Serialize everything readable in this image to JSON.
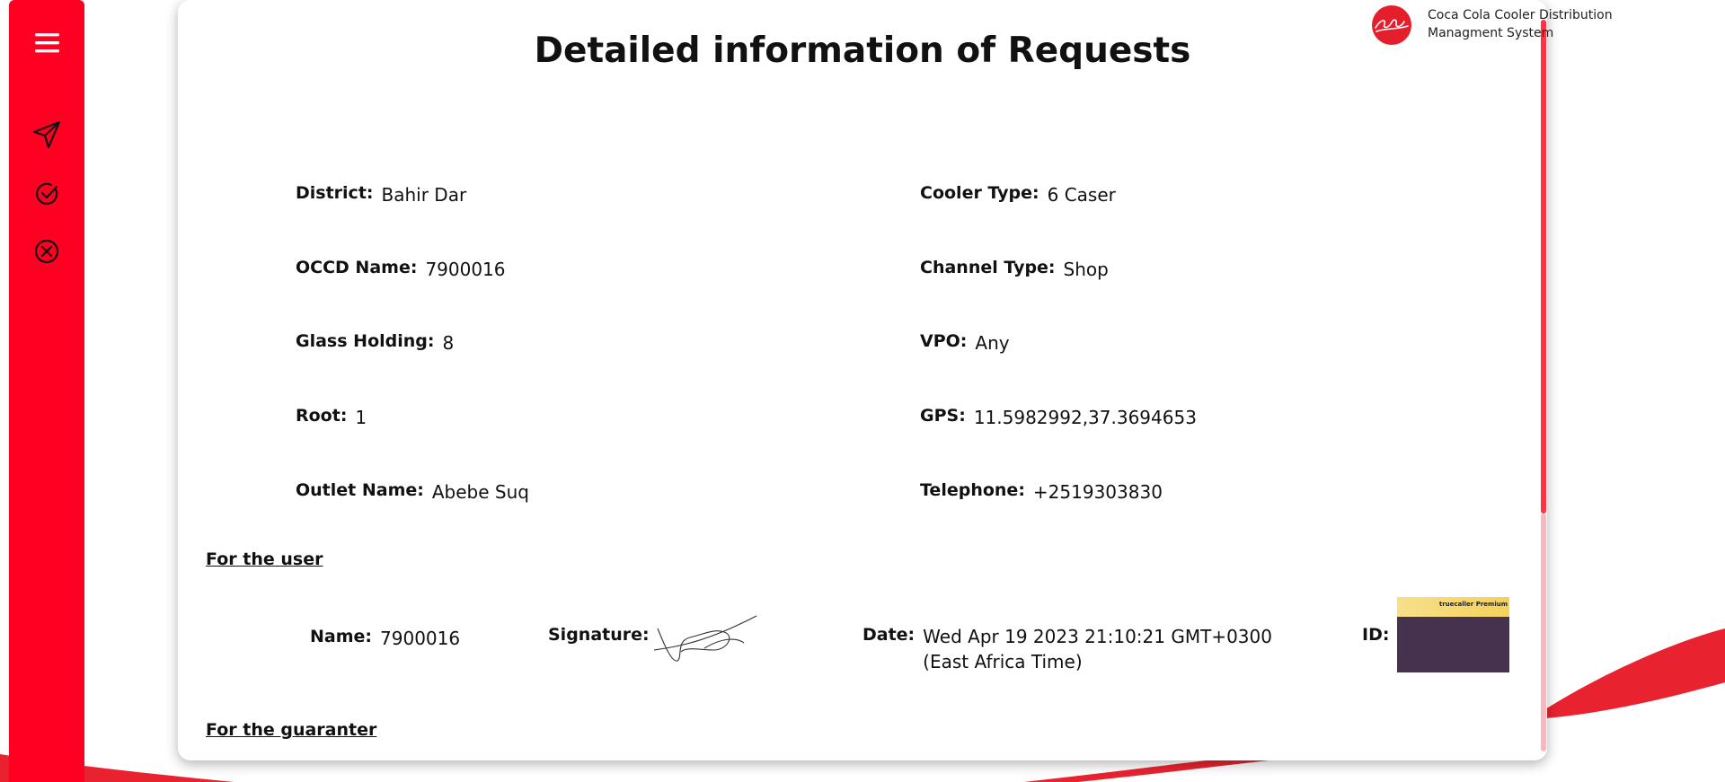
{
  "app": {
    "name_line1": "Coca Cola Cooler Distribution",
    "name_line2": "Managment System",
    "logo_text": "Coca-Cola",
    "brand_color": "#ff0022"
  },
  "sidebar": {
    "items": [
      {
        "icon": "menu-icon"
      },
      {
        "icon": "send-icon"
      },
      {
        "icon": "check-circle-icon"
      },
      {
        "icon": "close-circle-icon"
      }
    ]
  },
  "page": {
    "title": "Detailed information of Requests"
  },
  "details": {
    "district": {
      "label": "District:",
      "value": "Bahir Dar"
    },
    "occd_name": {
      "label": "OCCD Name:",
      "value": "7900016"
    },
    "glass_holding": {
      "label": "Glass Holding:",
      "value": "8"
    },
    "root": {
      "label": "Root:",
      "value": "1"
    },
    "outlet_name": {
      "label": "Outlet Name:",
      "value": "Abebe Suq"
    },
    "cooler_type": {
      "label": "Cooler Type:",
      "value": "6 Caser"
    },
    "channel_type": {
      "label": "Channel Type:",
      "value": "Shop"
    },
    "vpo": {
      "label": "VPO:",
      "value": "Any"
    },
    "gps": {
      "label": "GPS:",
      "value": "11.5982992,37.3694653"
    },
    "telephone": {
      "label": "Telephone:",
      "value": "+2519303830"
    }
  },
  "user_section": {
    "heading": "For the user",
    "name_label": "Name:",
    "name_value": "7900016",
    "signature_label": "Signature:",
    "date_label": "Date:",
    "date_line1": "Wed Apr 19 2023 21:10:21 GMT+0300",
    "date_line2": "(East Africa Time)",
    "id_label": "ID:",
    "id_image_text": "truecaller Premium"
  },
  "guarantor_section": {
    "heading": "For the guaranter"
  }
}
